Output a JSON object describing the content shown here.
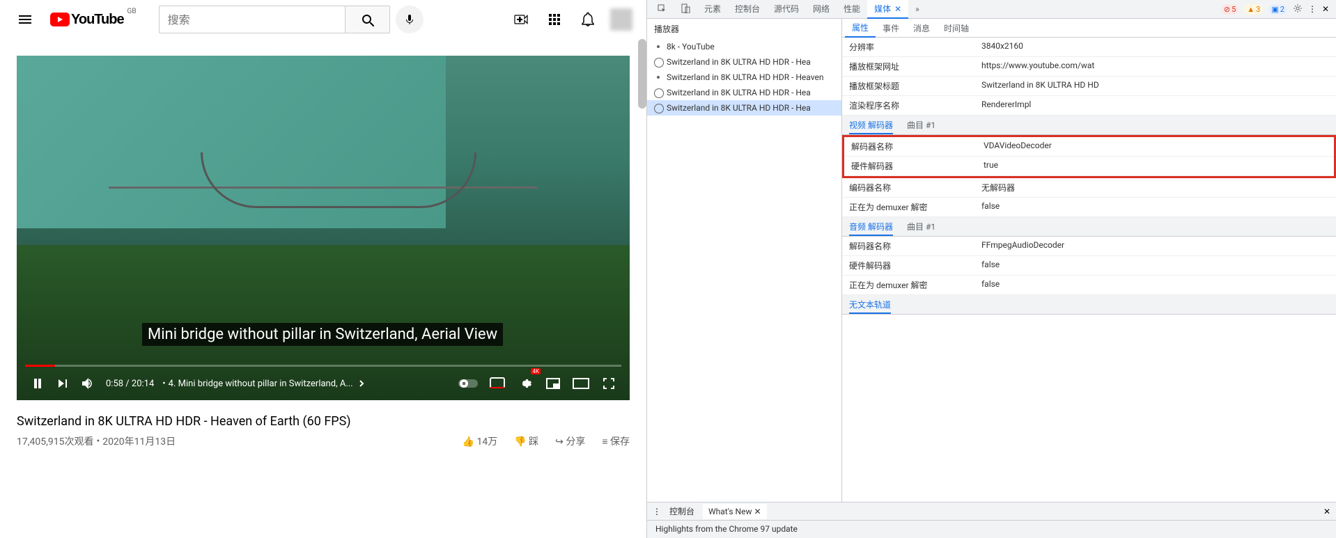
{
  "youtube": {
    "region": "GB",
    "logo_text": "YouTube",
    "search_placeholder": "搜索",
    "caption": "Mini bridge without pillar in Switzerland, Aerial View",
    "current_time": "0:58",
    "duration": "20:14",
    "chapter_sep": "•",
    "chapter": "4. Mini bridge without pillar in Switzerland, A...",
    "quality_badge": "4K",
    "title": "Switzerland in 8K ULTRA HD HDR - Heaven of Earth (60 FPS)",
    "views": "17,405,915次观看",
    "date": "2020年11月13日",
    "likes": "14万",
    "dislike": "踩",
    "share": "分享",
    "save": "保存"
  },
  "devtools": {
    "tabs": [
      "元素",
      "控制台",
      "源代码",
      "网络",
      "性能",
      "媒体"
    ],
    "active_tab": "媒体",
    "errors": "5",
    "warnings": "3",
    "info": "2",
    "players_header": "播放器",
    "players": [
      {
        "label": "8k - YouTube",
        "bullet": true
      },
      {
        "label": "Switzerland in 8K ULTRA HD HDR - Hea"
      },
      {
        "label": "Switzerland in 8K ULTRA HD HDR - Heaven",
        "bullet": true
      },
      {
        "label": "Switzerland in 8K ULTRA HD HDR - Hea"
      },
      {
        "label": "Switzerland in 8K ULTRA HD HDR - Hea",
        "selected": true
      }
    ],
    "subtabs": [
      "属性",
      "事件",
      "消息",
      "时间轴"
    ],
    "active_subtab": "属性",
    "props": [
      {
        "key": "分辨率",
        "val": "3840x2160"
      },
      {
        "key": "播放框架网址",
        "val": "https://www.youtube.com/wat"
      },
      {
        "key": "播放框架标题",
        "val": "Switzerland in 8K ULTRA HD HD"
      },
      {
        "key": "渲染程序名称",
        "val": "RendererImpl"
      }
    ],
    "video_decoder_section": {
      "label": "视频 解码器",
      "track": "曲目 #1"
    },
    "video_decoder_props": [
      {
        "key": "解码器名称",
        "val": "VDAVideoDecoder",
        "hl": true
      },
      {
        "key": "硬件解码器",
        "val": "true",
        "hl": true
      },
      {
        "key": "编码器名称",
        "val": "无解码器"
      },
      {
        "key": "正在为 demuxer 解密",
        "val": "false"
      }
    ],
    "audio_decoder_section": {
      "label": "音频 解码器",
      "track": "曲目 #1"
    },
    "audio_decoder_props": [
      {
        "key": "解码器名称",
        "val": "FFmpegAudioDecoder"
      },
      {
        "key": "硬件解码器",
        "val": "false"
      },
      {
        "key": "正在为 demuxer 解密",
        "val": "false"
      }
    ],
    "no_text_track": "无文本轨道",
    "bottom_tabs": [
      "控制台",
      "What's New"
    ],
    "bottom_content": "Highlights from the Chrome 97 update"
  }
}
